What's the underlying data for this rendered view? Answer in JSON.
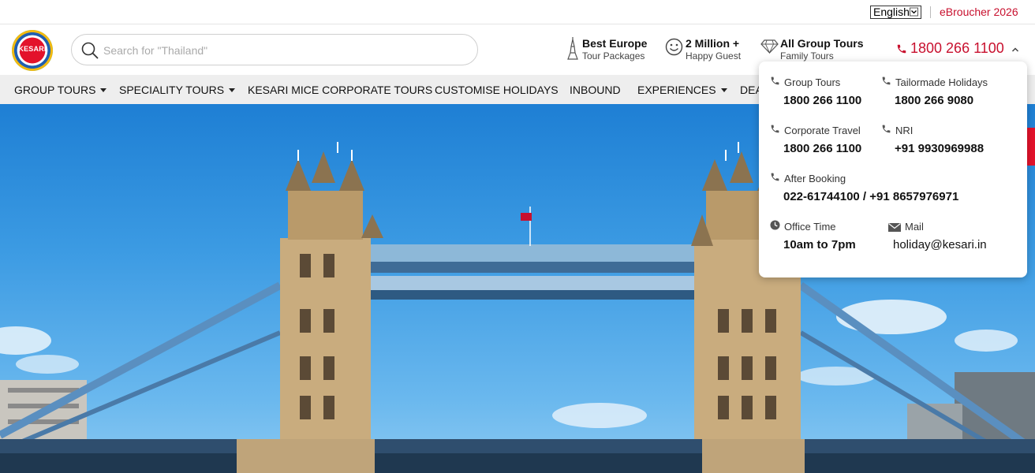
{
  "topbar": {
    "language": "English",
    "ebroucher": "eBroucher 2026"
  },
  "header": {
    "logo_text": "KESARI",
    "search_placeholder": "Search for \"Thailand\"",
    "features": [
      {
        "title": "Best Europe",
        "subtitle": "Tour Packages",
        "icon": "tower-icon"
      },
      {
        "title": "2 Million +",
        "subtitle": "Happy Guest",
        "icon": "smile-icon"
      },
      {
        "title": "All Group Tours",
        "subtitle": "Family Tours",
        "icon": "diamond-icon"
      }
    ],
    "phone": "1800 266 1100"
  },
  "nav": {
    "items": [
      {
        "label": "GROUP TOURS"
      },
      {
        "label": "SPECIALITY TOURS"
      },
      {
        "label": "KESARI MICE CORPORATE TOURS"
      },
      {
        "label": "CUSTOMISE HOLIDAYS"
      },
      {
        "label": "INBOUND"
      },
      {
        "label": "EXPERIENCES"
      },
      {
        "label": "DEA"
      }
    ]
  },
  "contact": {
    "group_tours_label": "Group Tours",
    "group_tours_number": "1800 266 1100",
    "tailormade_label": "Tailormade Holidays",
    "tailormade_number": "1800 266 9080",
    "corporate_label": "Corporate Travel",
    "corporate_number": "1800 266 1100",
    "nri_label": "NRI",
    "nri_number": "+91 9930969988",
    "after_booking_label": "After Booking",
    "after_booking_number": "022-61744100 / +91 8657976971",
    "office_time_label": "Office Time",
    "office_time_value": "10am to 7pm",
    "mail_label": "Mail",
    "mail_value": "holiday@kesari.in"
  },
  "colors": {
    "brand_red": "#c8102e",
    "nav_bg": "#eeeeee",
    "sky": "#3c9be3"
  }
}
